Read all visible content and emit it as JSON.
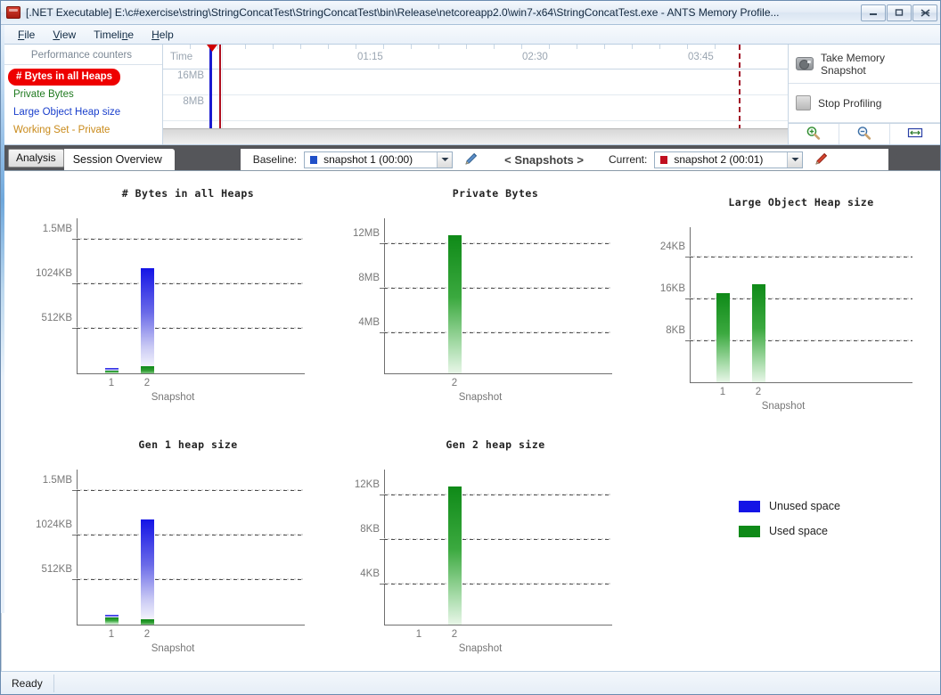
{
  "window": {
    "title": "[.NET Executable] E:\\c#exercise\\string\\StringConcatTest\\StringConcatTest\\bin\\Release\\netcoreapp2.0\\win7-x64\\StringConcatTest.exe - ANTS Memory Profile...",
    "app_icon": "ants-profiler-icon",
    "minimize": "minimize-icon",
    "maximize": "maximize-icon",
    "close": "close-icon"
  },
  "menu": {
    "items": [
      {
        "label": "File",
        "accel": "F"
      },
      {
        "label": "View",
        "accel": "V"
      },
      {
        "label": "Timeline",
        "accel": "n"
      },
      {
        "label": "Help",
        "accel": "H"
      }
    ]
  },
  "counters": {
    "title": "Performance counters",
    "items": [
      {
        "label": "# Bytes in all Heaps",
        "selected": true,
        "color": "#ffffff"
      },
      {
        "label": "Private Bytes",
        "selected": false,
        "color": "#1f7a1f"
      },
      {
        "label": "Large Object Heap size",
        "selected": false,
        "color": "#1a3fcc"
      },
      {
        "label": "Working Set - Private",
        "selected": false,
        "color": "#c98a1a"
      }
    ],
    "selected_bg": "#ee0000"
  },
  "timeline": {
    "time_label": "Time",
    "time_ticks": [
      "01:15",
      "02:30",
      "03:45"
    ],
    "y_ticks": [
      "16MB",
      "8MB"
    ],
    "snapshot_marker_blue": "#1a1ad0",
    "snapshot_marker_red": "#b01020",
    "current_position_line": "#a11226"
  },
  "actions": {
    "take_snapshot": "Take Memory Snapshot",
    "take_snapshot_icon": "camera-icon",
    "stop_profiling": "Stop Profiling",
    "stop_profiling_icon": "stop-icon",
    "zoom_in_icon": "zoom-in-icon",
    "zoom_out_icon": "zoom-out-icon",
    "zoom_fit_icon": "zoom-fit-icon"
  },
  "tabs": {
    "analysis": "Analysis",
    "session_overview": "Session Overview"
  },
  "snapshot_bar": {
    "baseline_label": "Baseline:",
    "baseline_value": "snapshot 1 (00:00)",
    "baseline_color": "#2050c8",
    "baseline_edit_icon": "pencil-icon",
    "nav_label": "< Snapshots >",
    "current_label": "Current:",
    "current_value": "snapshot 2 (00:01)",
    "current_color": "#c01020",
    "current_edit_icon": "pencil-icon",
    "dropdown_icon": "chevron-down-icon"
  },
  "legend": {
    "items": [
      {
        "label": "Unused space",
        "color": "#1414e6"
      },
      {
        "label": "Used space",
        "color": "#0f8a18"
      }
    ]
  },
  "status": {
    "text": "Ready"
  },
  "chart_data": [
    {
      "type": "bar",
      "title": "# Bytes in all Heaps",
      "xlabel": "Snapshot",
      "ylabel": "",
      "categories": [
        "1",
        "2"
      ],
      "ytick_labels": [
        "512KB",
        "1024KB",
        "1.5MB"
      ],
      "ytick_values": [
        512,
        1024,
        1536
      ],
      "ylim": [
        0,
        1800
      ],
      "unit": "KB",
      "grid": true,
      "series": [
        {
          "name": "Used space",
          "color": "#0f8a18",
          "values": [
            28,
            22
          ]
        },
        {
          "name": "Unused space",
          "color": "#1414e6",
          "values": [
            12,
            1128
          ]
        }
      ]
    },
    {
      "type": "bar",
      "title": "Private Bytes",
      "xlabel": "Snapshot",
      "ylabel": "",
      "categories": [
        "2"
      ],
      "ytick_labels": [
        "4MB",
        "8MB",
        "12MB"
      ],
      "ytick_values": [
        4,
        8,
        12
      ],
      "ylim": [
        0,
        14.6
      ],
      "unit": "MB",
      "grid": true,
      "series": [
        {
          "name": "Used space",
          "color": "#0f8a18",
          "values": [
            12.7
          ]
        }
      ]
    },
    {
      "type": "bar",
      "title": "Large Object Heap size",
      "xlabel": "Snapshot",
      "ylabel": "",
      "categories": [
        "1",
        "2"
      ],
      "ytick_labels": [
        "8KB",
        "16KB",
        "24KB"
      ],
      "ytick_values": [
        8,
        16,
        24
      ],
      "ylim": [
        0,
        29
      ],
      "unit": "KB",
      "grid": true,
      "series": [
        {
          "name": "Used space",
          "color": "#0f8a18",
          "values": [
            16.9,
            18.6
          ]
        }
      ]
    },
    {
      "type": "bar",
      "title": "Gen 1 heap size",
      "xlabel": "Snapshot",
      "ylabel": "",
      "categories": [
        "1",
        "2"
      ],
      "ytick_labels": [
        "512KB",
        "1024KB",
        "1.5MB"
      ],
      "ytick_values": [
        512,
        1024,
        1536
      ],
      "ylim": [
        0,
        1800
      ],
      "unit": "KB",
      "grid": true,
      "series": [
        {
          "name": "Used space",
          "color": "#0f8a18",
          "values": [
            28,
            22
          ]
        },
        {
          "name": "Unused space",
          "color": "#1414e6",
          "values": [
            12,
            1128
          ]
        }
      ]
    },
    {
      "type": "bar",
      "title": "Gen 2 heap size",
      "xlabel": "Snapshot",
      "ylabel": "",
      "categories": [
        "1",
        "2"
      ],
      "ytick_labels": [
        "4KB",
        "8KB",
        "12KB"
      ],
      "ytick_values": [
        4,
        8,
        12
      ],
      "ylim": [
        0,
        14.6
      ],
      "unit": "KB",
      "grid": true,
      "series": [
        {
          "name": "Used space",
          "color": "#0f8a18",
          "values": [
            0,
            12.7
          ]
        }
      ]
    }
  ]
}
